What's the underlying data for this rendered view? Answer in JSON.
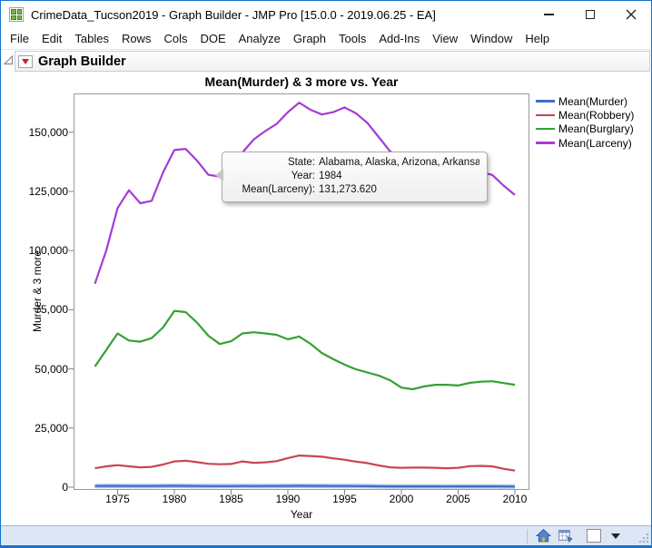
{
  "window": {
    "title": "CrimeData_Tucson2019 - Graph Builder - JMP Pro [15.0.0 - 2019.06.25 - EA]"
  },
  "menu": {
    "items": [
      "File",
      "Edit",
      "Tables",
      "Rows",
      "Cols",
      "DOE",
      "Analyze",
      "Graph",
      "Tools",
      "Add-Ins",
      "View",
      "Window",
      "Help"
    ]
  },
  "outline": {
    "title": "Graph Builder"
  },
  "tooltip": {
    "rows": [
      {
        "label": "State:",
        "value": "Alabama, Alaska, Arizona, Arkansas, ..."
      },
      {
        "label": "Year:",
        "value": "1984"
      },
      {
        "label": "Mean(Larceny):",
        "value": "131,273.620"
      }
    ]
  },
  "statusbar": {
    "icons": [
      "home-icon",
      "data-table-icon",
      "selection-box",
      "dropdown-arrow-icon"
    ]
  },
  "chart_data": {
    "type": "line",
    "title": "Mean(Murder) & 3 more vs. Year",
    "xlabel": "Year",
    "ylabel": "Murder & 3 more",
    "grid": false,
    "legend_position": "right",
    "xlim": [
      1971.5,
      2011.5
    ],
    "ylim": [
      0,
      166000
    ],
    "xticks": [
      1975,
      1980,
      1985,
      1990,
      1995,
      2000,
      2005,
      2010
    ],
    "yticks": {
      "values": [
        0,
        25000,
        50000,
        75000,
        100000,
        125000,
        150000
      ],
      "labels": [
        "0",
        "25,000",
        "50,000",
        "75,000",
        "100,000",
        "125,000",
        "150,000"
      ]
    },
    "x": [
      1973,
      1974,
      1975,
      1976,
      1977,
      1978,
      1979,
      1980,
      1981,
      1982,
      1983,
      1984,
      1985,
      1986,
      1987,
      1988,
      1989,
      1990,
      1991,
      1992,
      1993,
      1994,
      1995,
      1996,
      1997,
      1998,
      1999,
      2000,
      2001,
      2002,
      2003,
      2004,
      2005,
      2006,
      2007,
      2008,
      2009,
      2010
    ],
    "series": [
      {
        "name": "Mean(Murder)",
        "color": "#3f6ec6",
        "highlighted": true,
        "values": [
          510,
          540,
          520,
          500,
          480,
          500,
          520,
          560,
          540,
          510,
          470,
          450,
          460,
          480,
          470,
          480,
          500,
          540,
          560,
          530,
          520,
          500,
          480,
          450,
          430,
          390,
          360,
          340,
          350,
          340,
          330,
          320,
          330,
          340,
          340,
          330,
          300,
          280
        ]
      },
      {
        "name": "Mean(Robbery)",
        "color": "#c9454f",
        "highlighted": false,
        "values": [
          8000,
          8800,
          9300,
          8800,
          8400,
          8600,
          9600,
          10900,
          11200,
          10600,
          9900,
          9700,
          9800,
          10900,
          10300,
          10500,
          11000,
          12300,
          13400,
          13200,
          12900,
          12200,
          11600,
          10800,
          10200,
          9200,
          8400,
          8200,
          8300,
          8300,
          8200,
          8000,
          8200,
          8900,
          9000,
          8800,
          7800,
          7000
        ]
      },
      {
        "name": "Mean(Burglary)",
        "color": "#33a133",
        "highlighted": false,
        "values": [
          51000,
          58000,
          65000,
          62000,
          61500,
          63000,
          67500,
          74500,
          74000,
          69500,
          64000,
          60500,
          61700,
          65000,
          65500,
          65000,
          64400,
          62500,
          63700,
          60600,
          56700,
          54100,
          51800,
          49800,
          48500,
          47200,
          45200,
          42100,
          41400,
          42600,
          43300,
          43300,
          43000,
          44100,
          44600,
          44800,
          44000,
          43300
        ]
      },
      {
        "name": "Mean(Larceny)",
        "color": "#a63bd4",
        "highlighted": false,
        "values": [
          86000,
          100000,
          118000,
          125500,
          120000,
          121000,
          133000,
          142500,
          143000,
          138000,
          132000,
          131273.62,
          136500,
          141500,
          147000,
          150500,
          153500,
          158500,
          162500,
          159500,
          157500,
          158500,
          160500,
          158000,
          154000,
          148000,
          142000,
          138500,
          136500,
          135000,
          134000,
          133500,
          133000,
          133500,
          133000,
          132000,
          127500,
          123500
        ]
      }
    ],
    "annotation": {
      "year": 1984,
      "series": "Mean(Larceny)",
      "value": 131273.62
    }
  }
}
